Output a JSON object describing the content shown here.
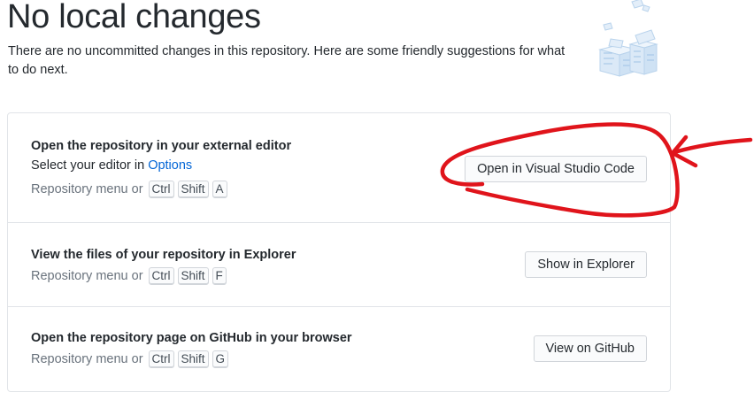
{
  "header": {
    "title": "No local changes",
    "subtitle": "There are no uncommitted changes in this repository. Here are some friendly suggestions for what to do next."
  },
  "suggestions": [
    {
      "title": "Open the repository in your external editor",
      "description_prefix": "Select your editor in ",
      "description_link": "Options",
      "shortcut_label": "Repository menu or",
      "keys": [
        "Ctrl",
        "Shift",
        "A"
      ],
      "button": "Open in Visual Studio Code"
    },
    {
      "title": "View the files of your repository in Explorer",
      "shortcut_label": "Repository menu or",
      "keys": [
        "Ctrl",
        "Shift",
        "F"
      ],
      "button": "Show in Explorer"
    },
    {
      "title": "Open the repository page on GitHub in your browser",
      "shortcut_label": "Repository menu or",
      "keys": [
        "Ctrl",
        "Shift",
        "G"
      ],
      "button": "View on GitHub"
    }
  ],
  "annotation": {
    "color": "#e0141b",
    "shapes": [
      "circle-around-button",
      "arrow-pointing-left"
    ]
  },
  "colors": {
    "link": "#0366d6",
    "muted": "#6a737d",
    "border": "#e1e4e8"
  }
}
